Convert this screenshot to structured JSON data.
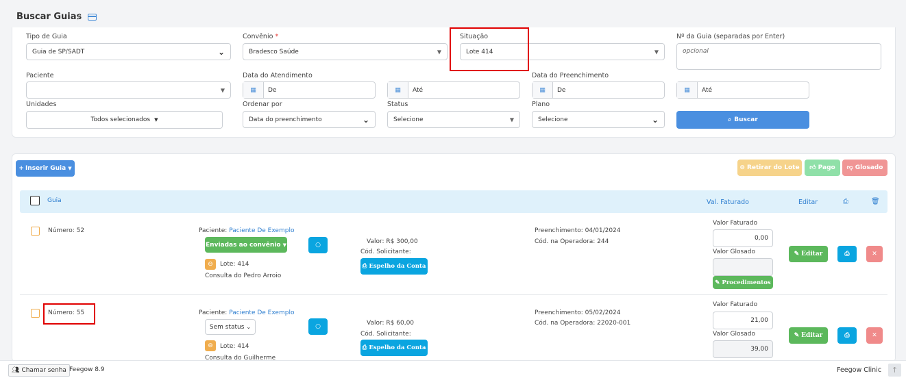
{
  "header": {
    "title": "Buscar Guias",
    "separator": "/"
  },
  "filters": {
    "tipo_label": "Tipo de Guia",
    "tipo_value": "Guia de SP/SADT",
    "convenio_label": "Convênio",
    "convenio_required": "*",
    "convenio_value": "Bradesco Saúde",
    "situacao_label": "Situação",
    "situacao_value": "Lote 414",
    "nguia_label": "Nº da Guia (separadas por Enter)",
    "nguia_placeholder": "opcional",
    "paciente_label": "Paciente",
    "data_atend_label": "Data do Atendimento",
    "de": "De",
    "ate": "Até",
    "data_preench_label": "Data do Preenchimento",
    "unidades_label": "Unidades",
    "unidades_value": "Todos selecionados",
    "ordenar_label": "Ordenar por",
    "ordenar_value": "Data do preenchimento",
    "status_label": "Status",
    "status_value": "Selecione",
    "plano_label": "Plano",
    "plano_value": "Selecione",
    "buscar": "Buscar"
  },
  "toolbar": {
    "inserir": "Inserir Guia",
    "retirar": "Retirar do Lote",
    "pago": "Pago",
    "glosado": "Glosado"
  },
  "table": {
    "col_guia": "Guia",
    "col_val": "Val. Faturado",
    "col_editar": "Editar"
  },
  "rows": [
    {
      "numero": "Número: 52",
      "paciente_label": "Paciente:",
      "paciente": "Paciente De Exemplo",
      "status": "Enviadas ao convênio",
      "lote": "Lote: 414",
      "descricao": "Consulta do Pedro Arroio",
      "valor": "Valor: R$ 300,00",
      "cod_sol": "Cód. Solicitante:",
      "espelho": "Espelho da Conta",
      "preench": "Preenchimento: 04/01/2024",
      "cod_op": "Cód. na Operadora: 244",
      "vf_label": "Valor Faturado",
      "vf": "0,00",
      "vg_label": "Valor Glosado",
      "vg": "",
      "procedimentos": "Procedimentos",
      "editar": "Editar"
    },
    {
      "numero": "Número: 55",
      "paciente_label": "Paciente:",
      "paciente": "Paciente De Exemplo",
      "status": "Sem status",
      "lote": "Lote: 414",
      "descricao": "Consulta do Guilherme",
      "valor": "Valor: R$ 60,00",
      "cod_sol": "Cód. Solicitante:",
      "espelho": "Espelho da Conta",
      "preench": "Preenchimento: 05/02/2024",
      "cod_op": "Cód. na Operadora: 22020-001",
      "vf_label": "Valor Faturado",
      "vf": "21,00",
      "vg_label": "Valor Glosado",
      "vg": "39,00",
      "editar": "Editar"
    }
  ],
  "footer": {
    "chamar": "Chamar senha",
    "version": "Feegow 8.9",
    "brand": "Feegow Clinic"
  },
  "colors": {
    "accent": "#4a8fd8",
    "green": "#5cb85c",
    "cyan": "#0aa5e0",
    "red_box": "#e00000"
  }
}
